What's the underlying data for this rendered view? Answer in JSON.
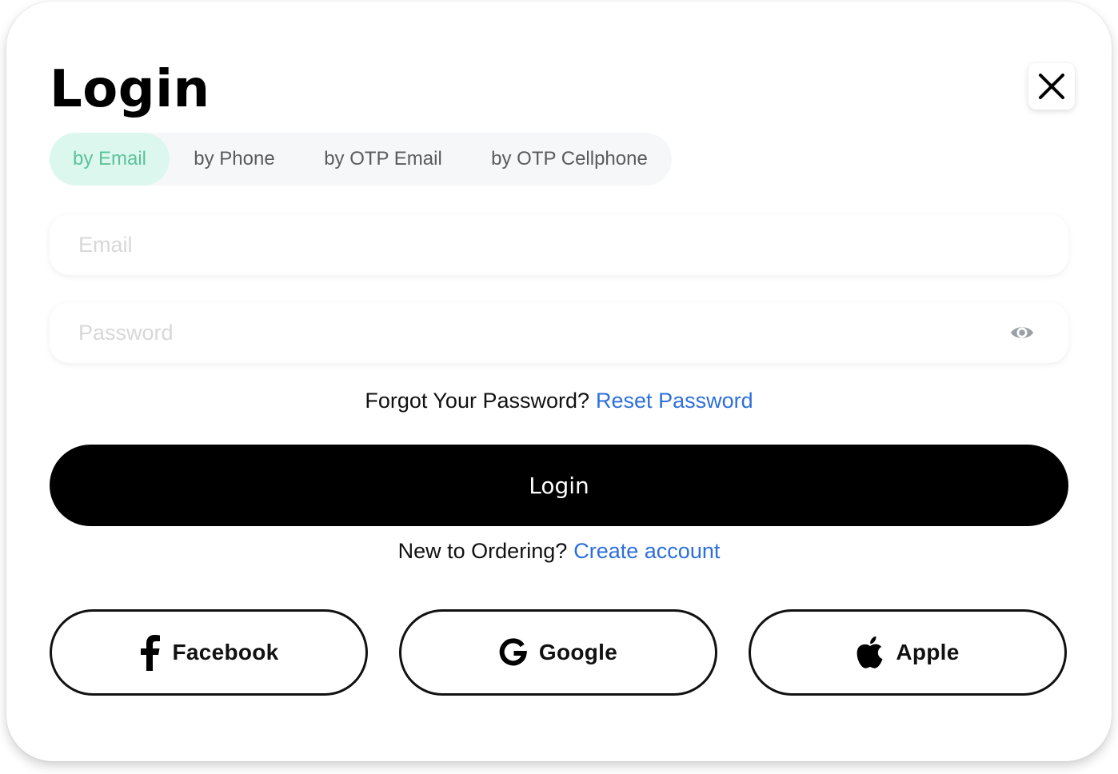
{
  "title": "Login",
  "tabs": [
    {
      "label": "by Email",
      "active": true
    },
    {
      "label": "by Phone",
      "active": false
    },
    {
      "label": "by OTP Email",
      "active": false
    },
    {
      "label": "by OTP Cellphone",
      "active": false
    }
  ],
  "fields": {
    "email": {
      "placeholder": "Email",
      "value": ""
    },
    "password": {
      "placeholder": "Password",
      "value": ""
    }
  },
  "forgot": {
    "text": "Forgot Your Password?",
    "link": "Reset Password"
  },
  "login_button": "Login",
  "signup": {
    "text": "New to Ordering?",
    "link": "Create account"
  },
  "social": [
    {
      "label": "Facebook",
      "icon": "facebook-icon"
    },
    {
      "label": "Google",
      "icon": "google-icon"
    },
    {
      "label": "Apple",
      "icon": "apple-icon"
    }
  ],
  "colors": {
    "accent_tab_bg": "#dcf8ee",
    "accent_tab_text": "#5dc29a",
    "link": "#2d6fdb",
    "primary_button": "#000000"
  },
  "icons": {
    "close": "close-icon",
    "password_toggle": "eye-icon"
  }
}
